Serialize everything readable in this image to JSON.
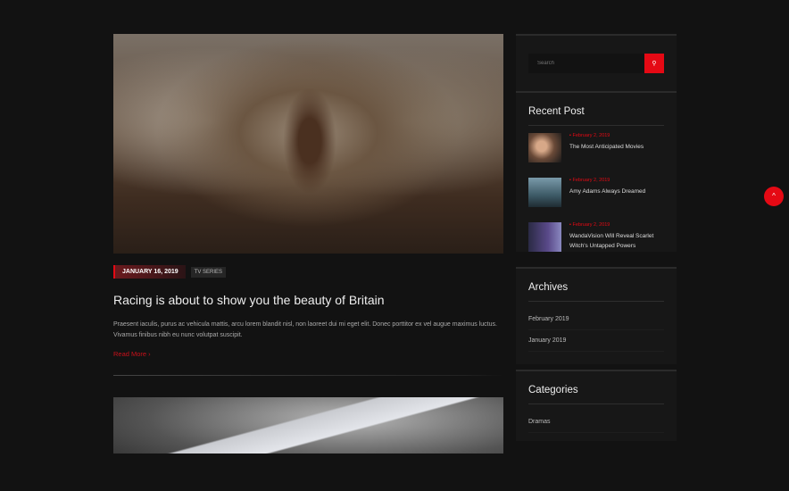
{
  "post": {
    "date": "JANUARY 16, 2019",
    "category": "TV SERIES",
    "title": "Racing is about to show you the beauty of Britain",
    "excerpt": "Praesent iaculis, purus ac vehicula mattis, arcu lorem blandit nisl, non laoreet dui mi eget elit. Donec porttitor ex vel augue maximus luctus. Vivamus finibus nibh eu nunc volutpat suscipit.",
    "read_more": "Read More ›"
  },
  "search": {
    "placeholder": "Search",
    "icon": "search-icon"
  },
  "recent": {
    "title": "Recent Post",
    "items": [
      {
        "date": "February 2, 2019",
        "title": "The Most Anticipated Movies"
      },
      {
        "date": "February 2, 2019",
        "title": "Amy Adams Always Dreamed"
      },
      {
        "date": "February 2, 2019",
        "title": "WandaVision Will Reveal Scarlet Witch's Untapped Powers"
      }
    ]
  },
  "archives": {
    "title": "Archives",
    "items": [
      "February 2019",
      "January 2019"
    ]
  },
  "categories": {
    "title": "Categories",
    "items": [
      "Dramas"
    ]
  },
  "colors": {
    "accent": "#e50914",
    "background": "#121212"
  }
}
